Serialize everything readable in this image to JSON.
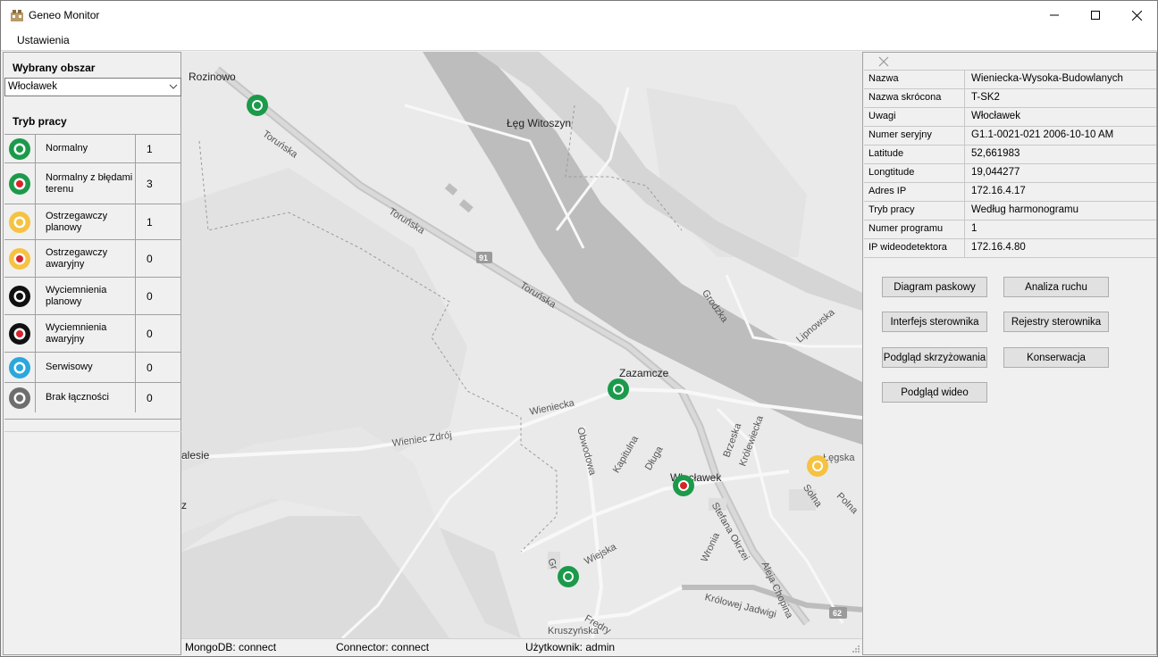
{
  "window": {
    "title": "Geneo Monitor"
  },
  "menu": {
    "items": [
      "Ustawienia"
    ]
  },
  "left_panel": {
    "area_label": "Wybrany obszar",
    "area_value": "Włocławek",
    "mode_label": "Tryb pracy",
    "modes": [
      {
        "label": "Normalny",
        "count": "1",
        "ring": "#1c9a4b",
        "center": "#1c9a4b"
      },
      {
        "label": "Normalny z błędami terenu",
        "count": "3",
        "ring": "#1c9a4b",
        "center": "#d8232a"
      },
      {
        "label": "Ostrzegawczy planowy",
        "count": "1",
        "ring": "#f5c242",
        "center": "#f5c242"
      },
      {
        "label": "Ostrzegawczy awaryjny",
        "count": "0",
        "ring": "#f5c242",
        "center": "#d8232a"
      },
      {
        "label": "Wyciemnienia planowy",
        "count": "0",
        "ring": "#111111",
        "center": "#111111"
      },
      {
        "label": "Wyciemnienia awaryjny",
        "count": "0",
        "ring": "#111111",
        "center": "#d8232a"
      },
      {
        "label": "Serwisowy",
        "count": "0",
        "ring": "#2aa7dc",
        "center": "#2aa7dc"
      },
      {
        "label": "Brak łączności",
        "count": "0",
        "ring": "#6e6e6e",
        "center": "#6e6e6e"
      }
    ]
  },
  "map": {
    "places": {
      "rozinowo": "Rozinowo",
      "leg_witoszyn": "Łęg Witoszyn",
      "zazamcze": "Zazamcze",
      "wloclawek": "Włocławek",
      "alesie": "alesie",
      "z": "z"
    },
    "roads": {
      "torunska1": "Toruńska",
      "torunska2": "Toruńska",
      "torunska3": "Toruńska",
      "wieniecka": "Wieniecka",
      "wieniec_zdroj": "Wieniec Zdrój",
      "obwodowa": "Obwodowa",
      "kapitulna": "Kapitulna",
      "dluga": "Długa",
      "brzeska": "Brzeska",
      "krolewiecka": "Królewiecka",
      "stefana_okrzei": "Stefana Okrzei",
      "aleja_chopina": "Aleja Chopina",
      "krolowej_jadwigi": "Królowej Jadwigi",
      "wiejska": "Wiejska",
      "fredry": "Fredry",
      "kruszynska": "Kruszyńska",
      "grodzka": "Grodzka",
      "lipnowska": "Lipnowska",
      "legska": "Łęgska",
      "polna": "Polna",
      "wronia": "Wronia",
      "solna": "Solna",
      "sw": "Gr"
    },
    "shields": {
      "r91": "91",
      "r62": "62"
    },
    "markers": [
      {
        "id": "m1",
        "ring": "#1c9a4b",
        "center": "#1c9a4b"
      },
      {
        "id": "m2",
        "ring": "#1c9a4b",
        "center": "#1c9a4b"
      },
      {
        "id": "m3",
        "ring": "#1c9a4b",
        "center": "#d8232a"
      },
      {
        "id": "m4",
        "ring": "#1c9a4b",
        "center": "#1c9a4b"
      },
      {
        "id": "m5",
        "ring": "#f5c242",
        "center": "#f5c242"
      }
    ]
  },
  "status": {
    "mongodb": "MongoDB: connect",
    "connector": "Connector: connect",
    "user": "Użytkownik: admin"
  },
  "details": {
    "rows": [
      {
        "key": "Nazwa",
        "value": "Wieniecka-Wysoka-Budowlanych"
      },
      {
        "key": "Nazwa skrócona",
        "value": "T-SK2"
      },
      {
        "key": "Uwagi",
        "value": "Włocławek"
      },
      {
        "key": "Numer seryjny",
        "value": "G1.1-0021-021 2006-10-10 AM"
      },
      {
        "key": "Latitude",
        "value": "52,661983"
      },
      {
        "key": "Longtitude",
        "value": "19,044277"
      },
      {
        "key": "Adres IP",
        "value": "172.16.4.17"
      },
      {
        "key": "Tryb pracy",
        "value": "Według harmonogramu"
      },
      {
        "key": "Numer programu",
        "value": "1"
      },
      {
        "key": "IP wideodetektora",
        "value": "172.16.4.80"
      }
    ],
    "buttons": {
      "diagram": "Diagram paskowy",
      "analiza": "Analiza ruchu",
      "interfejs": "Interfejs sterownika",
      "rejestry": "Rejestry sterownika",
      "podglad_skrz": "Podgląd skrzyżowania",
      "konserwacja": "Konserwacja",
      "podglad_wideo": "Podgląd wideo"
    }
  }
}
